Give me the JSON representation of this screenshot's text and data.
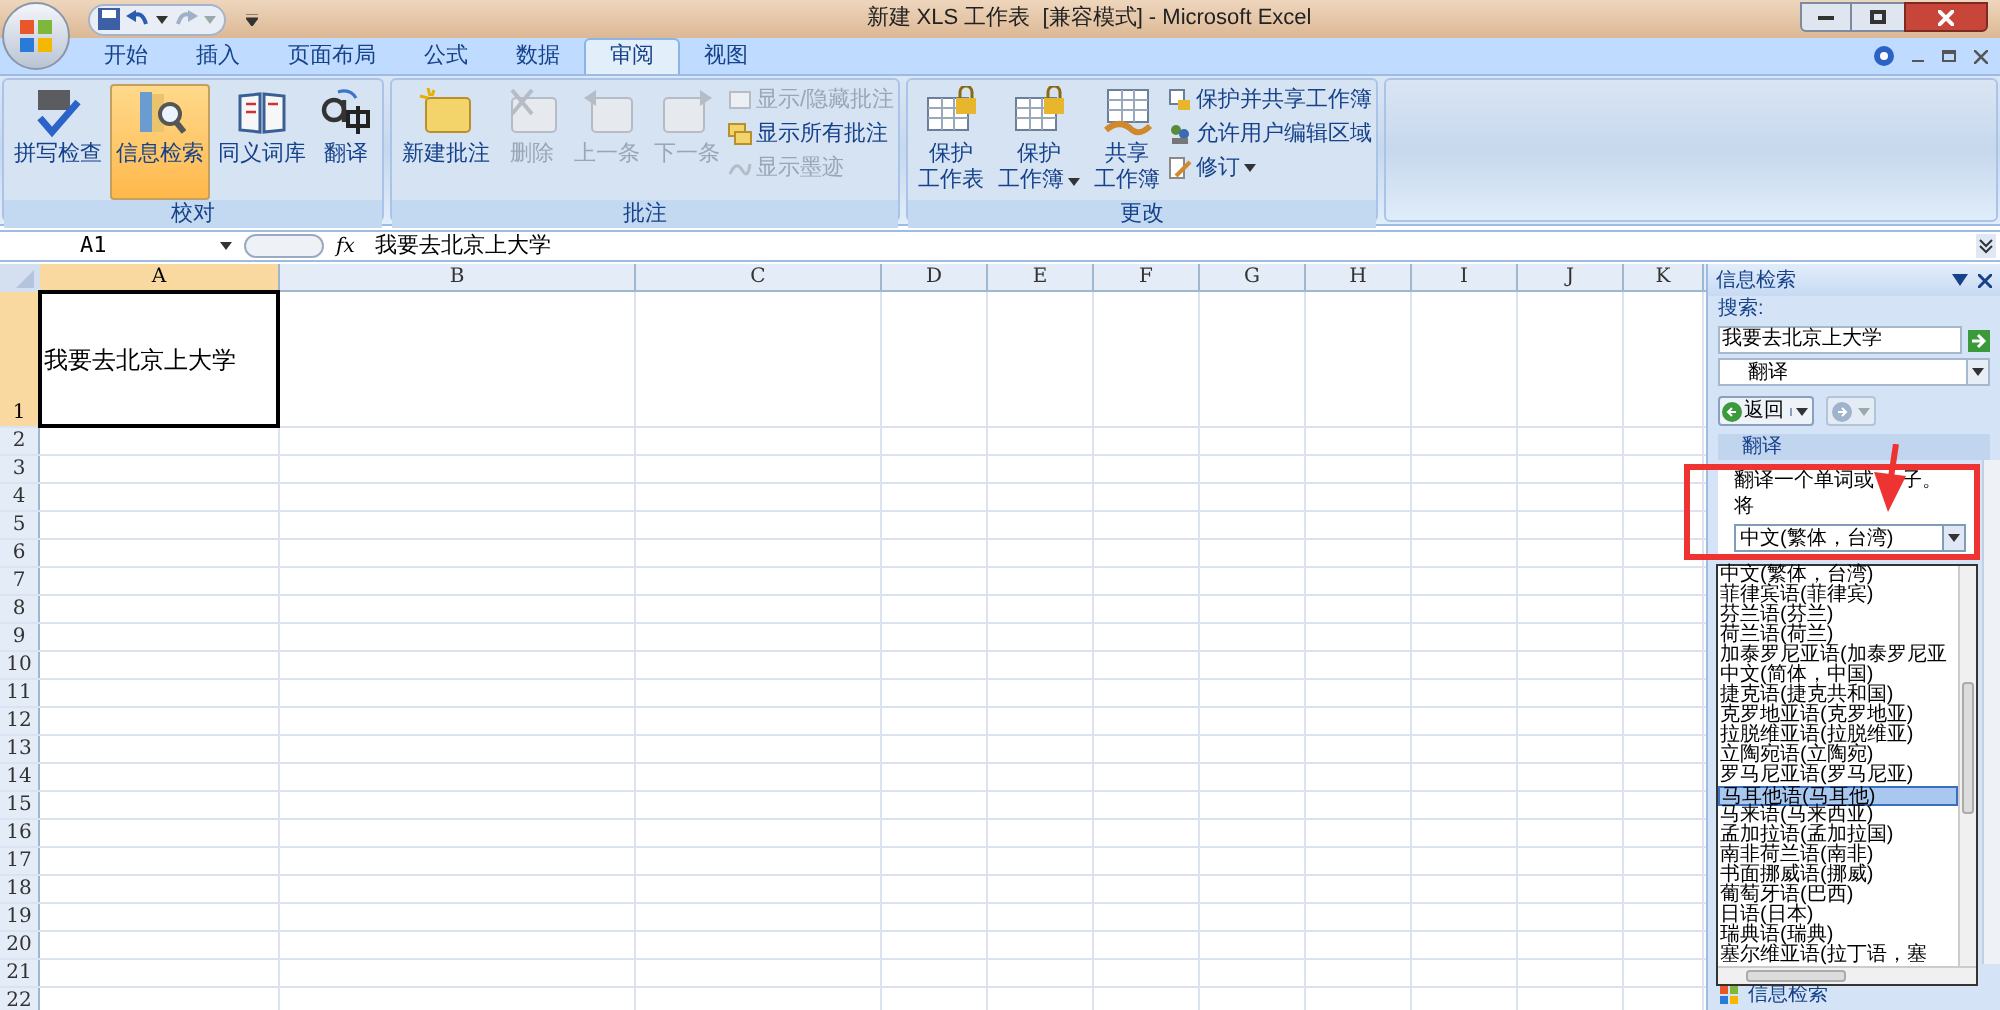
{
  "window": {
    "title": "新建 XLS 工作表  [兼容模式] - Microsoft Excel"
  },
  "tabs": [
    {
      "label": "开始",
      "selected": false
    },
    {
      "label": "插入",
      "selected": false
    },
    {
      "label": "页面布局",
      "selected": false
    },
    {
      "label": "公式",
      "selected": false
    },
    {
      "label": "数据",
      "selected": false
    },
    {
      "label": "审阅",
      "selected": true
    },
    {
      "label": "视图",
      "selected": false
    }
  ],
  "ribbon": {
    "groups": [
      {
        "label": "校对",
        "large": [
          {
            "lines": [
              "拼写检查"
            ],
            "selected": false,
            "disabled": false,
            "dropdown": false
          },
          {
            "lines": [
              "信息检索"
            ],
            "selected": true,
            "disabled": false,
            "dropdown": false
          },
          {
            "lines": [
              "同义词库"
            ],
            "selected": false,
            "disabled": false,
            "dropdown": false
          },
          {
            "lines": [
              "翻译"
            ],
            "selected": false,
            "disabled": false,
            "dropdown": false
          }
        ]
      },
      {
        "label": "批注",
        "large": [
          {
            "lines": [
              "新建批注"
            ],
            "selected": false,
            "disabled": false,
            "dropdown": false
          },
          {
            "lines": [
              "删除"
            ],
            "selected": false,
            "disabled": true,
            "dropdown": false
          },
          {
            "lines": [
              "上一条"
            ],
            "selected": false,
            "disabled": true,
            "dropdown": false
          },
          {
            "lines": [
              "下一条"
            ],
            "selected": false,
            "disabled": true,
            "dropdown": false
          }
        ],
        "small": [
          {
            "label": "显示/隐藏批注",
            "disabled": true,
            "dropdown": false
          },
          {
            "label": "显示所有批注",
            "disabled": false,
            "dropdown": false
          },
          {
            "label": "显示墨迹",
            "disabled": true,
            "dropdown": false
          }
        ]
      },
      {
        "label": "更改",
        "large": [
          {
            "lines": [
              "保护",
              "工作表"
            ],
            "selected": false,
            "disabled": false,
            "dropdown": false
          },
          {
            "lines": [
              "保护",
              "工作簿"
            ],
            "selected": false,
            "disabled": false,
            "dropdown": true
          },
          {
            "lines": [
              "共享",
              "工作簿"
            ],
            "selected": false,
            "disabled": false,
            "dropdown": false
          }
        ],
        "small": [
          {
            "label": "保护并共享工作簿",
            "disabled": false,
            "dropdown": false
          },
          {
            "label": "允许用户编辑区域",
            "disabled": false,
            "dropdown": false
          },
          {
            "label": "修订",
            "disabled": false,
            "dropdown": true
          }
        ]
      }
    ]
  },
  "formula_bar": {
    "name_box": "A1",
    "fx_label": "fx",
    "value": "我要去北京上大学"
  },
  "sheet": {
    "columns": [
      {
        "label": "A",
        "selected": true
      },
      {
        "label": "B",
        "selected": false
      },
      {
        "label": "C",
        "selected": false
      },
      {
        "label": "D",
        "selected": false
      },
      {
        "label": "E",
        "selected": false
      },
      {
        "label": "F",
        "selected": false
      },
      {
        "label": "G",
        "selected": false
      },
      {
        "label": "H",
        "selected": false
      },
      {
        "label": "I",
        "selected": false
      },
      {
        "label": "J",
        "selected": false
      },
      {
        "label": "K",
        "selected": false
      }
    ],
    "rows": [
      {
        "label": "1",
        "selected": true,
        "cell_a": "我要去北京上大学"
      },
      {
        "label": "2",
        "selected": false
      },
      {
        "label": "3",
        "selected": false
      },
      {
        "label": "4",
        "selected": false
      },
      {
        "label": "5",
        "selected": false
      },
      {
        "label": "6",
        "selected": false
      },
      {
        "label": "7",
        "selected": false
      },
      {
        "label": "8",
        "selected": false
      },
      {
        "label": "9",
        "selected": false
      },
      {
        "label": "10",
        "selected": false
      },
      {
        "label": "11",
        "selected": false
      },
      {
        "label": "12",
        "selected": false
      },
      {
        "label": "13",
        "selected": false
      },
      {
        "label": "14",
        "selected": false
      },
      {
        "label": "15",
        "selected": false
      },
      {
        "label": "16",
        "selected": false
      },
      {
        "label": "17",
        "selected": false
      },
      {
        "label": "18",
        "selected": false
      },
      {
        "label": "19",
        "selected": false
      },
      {
        "label": "20",
        "selected": false
      },
      {
        "label": "21",
        "selected": false
      },
      {
        "label": "22",
        "selected": false
      }
    ]
  },
  "research_pane": {
    "title": "信息检索",
    "search_label": "搜索:",
    "search_value": "我要去北京上大学",
    "source": "翻译",
    "back_label": "返回",
    "section": "翻译",
    "hint_parts": [
      "翻译一个单词或",
      "子。"
    ],
    "to_label": "将",
    "to_value": "中文(繁体，台湾)",
    "languages": [
      {
        "label": "中文(繁体，台湾)",
        "selected": false
      },
      {
        "label": "菲律宾语(菲律宾)",
        "selected": false
      },
      {
        "label": "芬兰语(芬兰)",
        "selected": false
      },
      {
        "label": "荷兰语(荷兰)",
        "selected": false
      },
      {
        "label": "加泰罗尼亚语(加泰罗尼亚",
        "selected": false
      },
      {
        "label": "中文(简体，中国)",
        "selected": false
      },
      {
        "label": "捷克语(捷克共和国)",
        "selected": false
      },
      {
        "label": "克罗地亚语(克罗地亚)",
        "selected": false
      },
      {
        "label": "拉脱维亚语(拉脱维亚)",
        "selected": false
      },
      {
        "label": "立陶宛语(立陶宛)",
        "selected": false
      },
      {
        "label": "罗马尼亚语(罗马尼亚)",
        "selected": false
      },
      {
        "label": "马耳他语(马耳他)",
        "selected": true
      },
      {
        "label": "马来语(马来西亚)",
        "selected": false
      },
      {
        "label": "孟加拉语(孟加拉国)",
        "selected": false
      },
      {
        "label": "南非荷兰语(南非)",
        "selected": false
      },
      {
        "label": "书面挪威语(挪威)",
        "selected": false
      },
      {
        "label": "葡萄牙语(巴西)",
        "selected": false
      },
      {
        "label": "日语(日本)",
        "selected": false
      },
      {
        "label": "瑞典语(瑞典)",
        "selected": false
      },
      {
        "label": "塞尔维亚语(拉丁语，塞",
        "selected": false
      }
    ],
    "footer": "信息检索"
  }
}
